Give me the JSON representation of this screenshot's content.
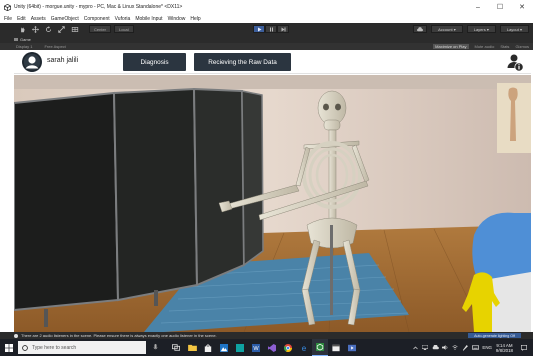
{
  "window": {
    "title": "Unity (64bit) - morgue.unity - mypro - PC, Mac & Linux Standalone* <DX11>",
    "minimize": "–",
    "maximize": "☐",
    "close": "✕"
  },
  "menu": [
    "File",
    "Edit",
    "Assets",
    "GameObject",
    "Component",
    "Vuforia",
    "Mobile Input",
    "Window",
    "Help"
  ],
  "toolbar": {
    "pivot_label": "Center",
    "space_label": "Local",
    "account_label": "Account",
    "layers_label": "Layers",
    "layout_label": "Layout"
  },
  "game_tab": {
    "label": "Game"
  },
  "game_controls": {
    "display": "Display 1",
    "aspect": "Free Aspect",
    "maximize_on_play": "Maximize on Play",
    "mute_audio": "Mute audio",
    "stats": "Stats",
    "gizmos": "Gizmos"
  },
  "app": {
    "username": "sarah jalili",
    "diagnosis_button": "Diagnosis",
    "raw_data_button": "Recieving the Raw Data"
  },
  "status": {
    "message": "There are 2 audio listeners in the scene. Please ensure there is always exactly one audio listener in the scene.",
    "auto_label": "Auto-generate lighting Off"
  },
  "taskbar": {
    "search_placeholder": "Type here to search",
    "language": "ENG",
    "time": "9:14 AM",
    "date": "9/8/2018"
  },
  "colors": {
    "unity_dark": "#2b2b2b",
    "app_button": "#2b3540",
    "play_blue": "#3d5f9c",
    "taskbar": "#1c1f26"
  }
}
